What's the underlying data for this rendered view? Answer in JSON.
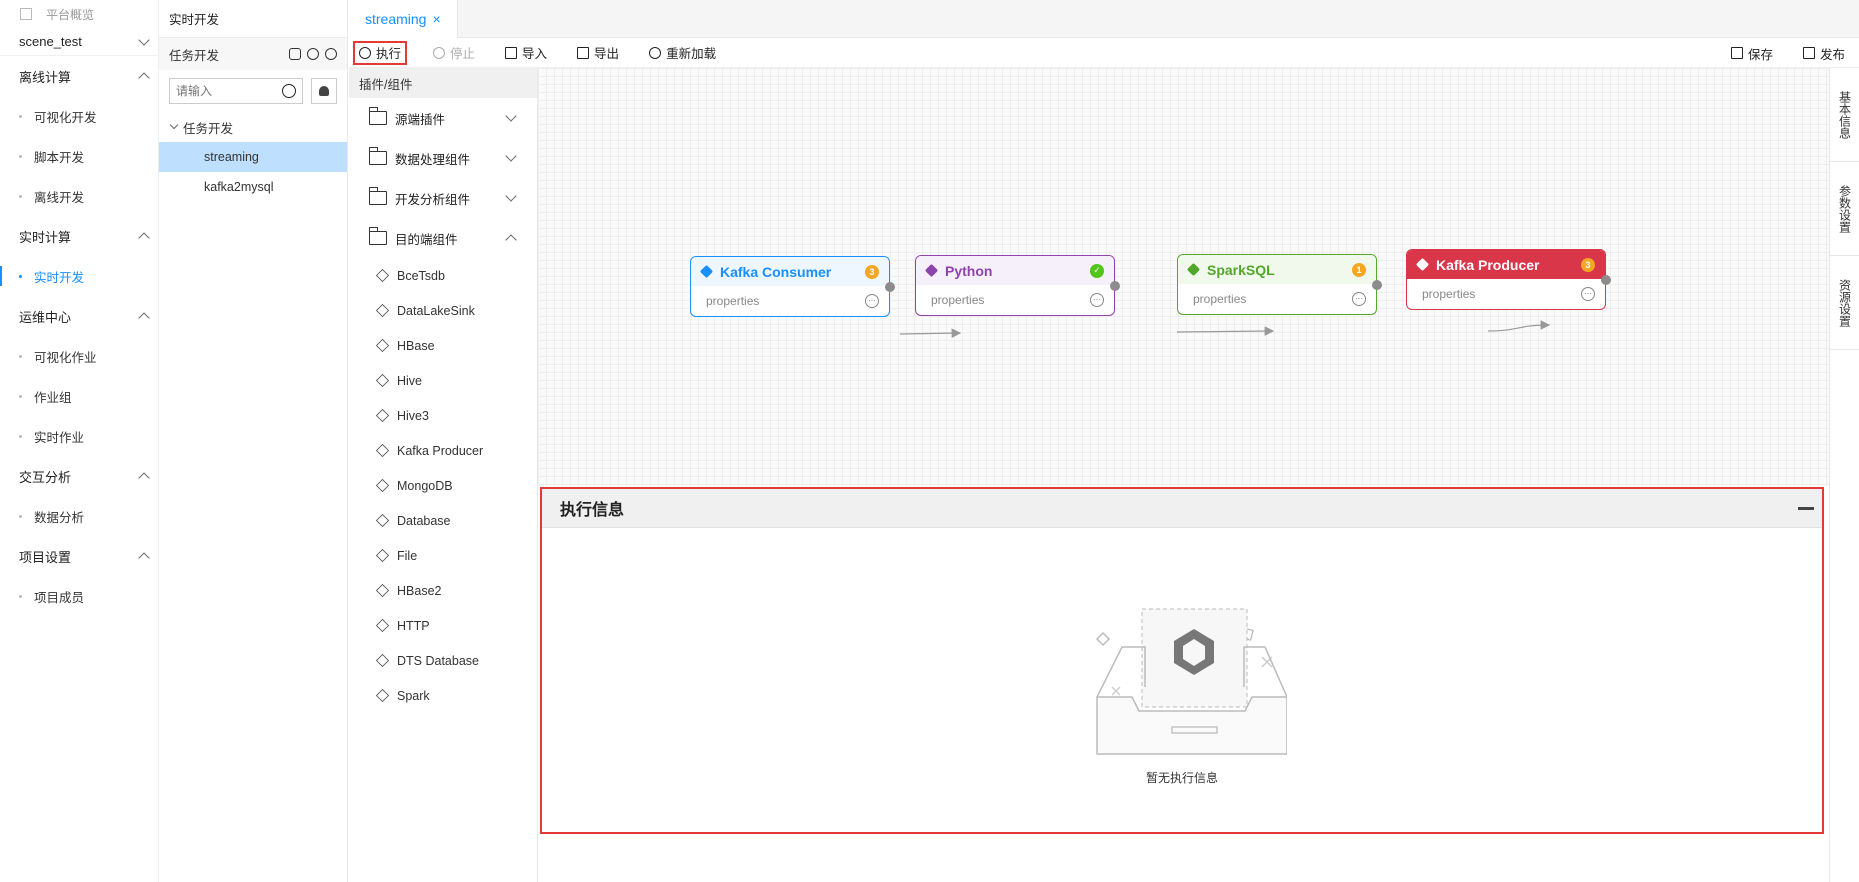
{
  "leftnav": {
    "overview": "平台概览",
    "project": "scene_test",
    "groups": [
      {
        "label": "离线计算",
        "items": [
          {
            "label": "可视化开发"
          },
          {
            "label": "脚本开发"
          },
          {
            "label": "离线开发"
          }
        ]
      },
      {
        "label": "实时计算",
        "items": [
          {
            "label": "实时开发",
            "active": true
          }
        ]
      },
      {
        "label": "运维中心",
        "items": [
          {
            "label": "可视化作业"
          },
          {
            "label": "作业组"
          },
          {
            "label": "实时作业"
          }
        ]
      },
      {
        "label": "交互分析",
        "items": [
          {
            "label": "数据分析"
          }
        ]
      },
      {
        "label": "项目设置",
        "items": [
          {
            "label": "项目成员"
          }
        ]
      }
    ]
  },
  "taskpanel": {
    "header": "实时开发",
    "sub_title": "任务开发",
    "search_placeholder": "请输入",
    "tree_parent": "任务开发",
    "tree_items": [
      "streaming",
      "kafka2mysql"
    ]
  },
  "tab": {
    "label": "streaming",
    "close": "×"
  },
  "toolbar": {
    "run": "执行",
    "stop": "停止",
    "import": "导入",
    "export": "导出",
    "reload": "重新加载",
    "save": "保存",
    "publish": "发布"
  },
  "plugins": {
    "title": "插件/组件",
    "groups": [
      "源端插件",
      "数据处理组件",
      "开发分析组件",
      "目的端组件"
    ],
    "items": [
      "BceTsdb",
      "DataLakeSink",
      "HBase",
      "Hive",
      "Hive3",
      "Kafka Producer",
      "MongoDB",
      "Database",
      "File",
      "HBase2",
      "HTTP",
      "DTS Database",
      "Spark"
    ]
  },
  "nodes": [
    {
      "name": "Kafka Consumer",
      "body": "properties",
      "badge": "3",
      "color": "#1890ff",
      "header_bg": "#eef6ff"
    },
    {
      "name": "Python",
      "body": "properties",
      "badge": "✓",
      "color": "#8e44ad",
      "header_bg": "#f6f0fb"
    },
    {
      "name": "SparkSQL",
      "body": "properties",
      "badge": "1",
      "color": "#52a72a",
      "header_bg": "#f1f9ec"
    },
    {
      "name": "Kafka Producer",
      "body": "properties",
      "badge": "3",
      "color": "#d9364a",
      "header_bg": "#d9364a"
    }
  ],
  "rightrail": [
    "基本信息",
    "参数设置",
    "资源设置"
  ],
  "exec": {
    "title": "执行信息",
    "empty_text": "暂无执行信息"
  }
}
